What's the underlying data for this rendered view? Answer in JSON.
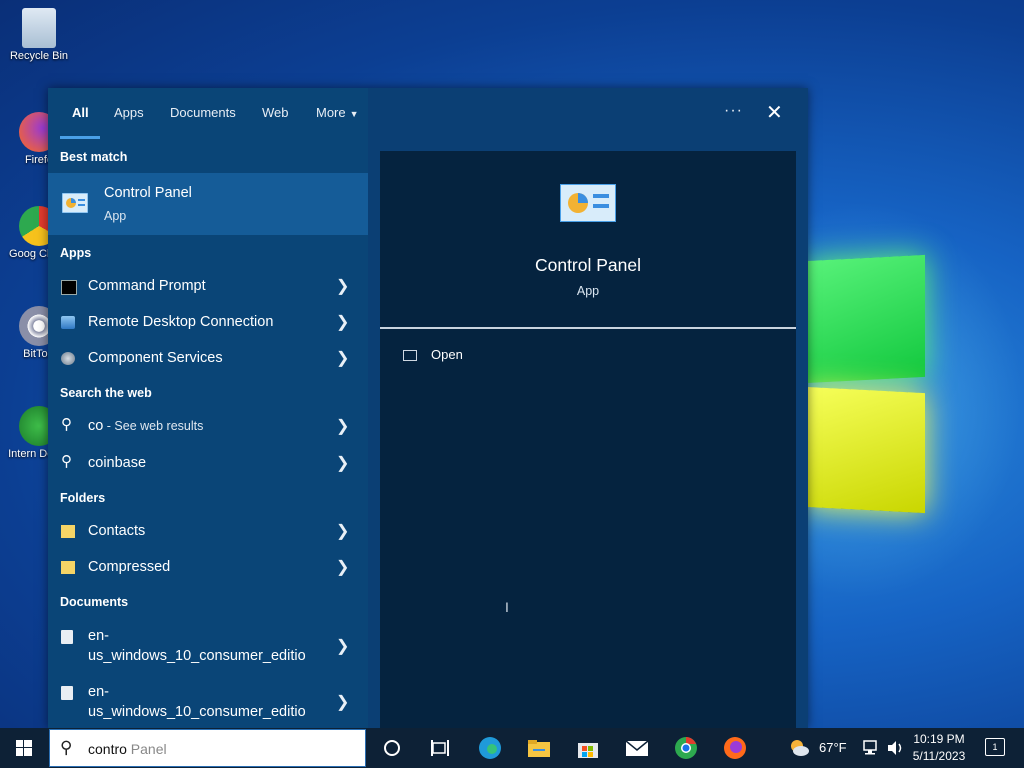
{
  "desktop": {
    "icons": [
      {
        "label": "Recycle Bin"
      },
      {
        "label": "Firefo"
      },
      {
        "label": "Goog Chron"
      },
      {
        "label": "BitTorr"
      },
      {
        "label": "Intern Downl"
      }
    ]
  },
  "start_menu": {
    "tabs": [
      {
        "label": "All"
      },
      {
        "label": "Apps"
      },
      {
        "label": "Documents"
      },
      {
        "label": "Web"
      },
      {
        "label": "More"
      }
    ],
    "more_icon": "ellipsis-icon",
    "close_icon": "close-icon",
    "best_match_heading": "Best match",
    "best_match": {
      "title": "Control Panel",
      "subtitle": "App"
    },
    "apps_heading": "Apps",
    "apps": [
      {
        "label": "Command Prompt"
      },
      {
        "label": "Remote Desktop Connection"
      },
      {
        "label": "Component Services"
      }
    ],
    "web_heading": "Search the web",
    "web": [
      {
        "label": "co",
        "suffix": " - See web results"
      },
      {
        "label": "coinbase"
      }
    ],
    "folders_heading": "Folders",
    "folders": [
      {
        "label": "Contacts"
      },
      {
        "label": "Compressed"
      }
    ],
    "documents_heading": "Documents",
    "documents": [
      {
        "line1": "en-",
        "line2": "us_windows_10_consumer_editio"
      },
      {
        "line1": "en-",
        "line2": "us_windows_10_consumer_editio"
      }
    ],
    "detail": {
      "title": "Control Panel",
      "subtitle": "App",
      "open_label": "Open"
    }
  },
  "taskbar": {
    "search_typed": "contro",
    "search_hint": " Panel",
    "weather": "67°F",
    "time": "10:19 PM",
    "date": "5/11/2023",
    "notification_count": "1"
  }
}
